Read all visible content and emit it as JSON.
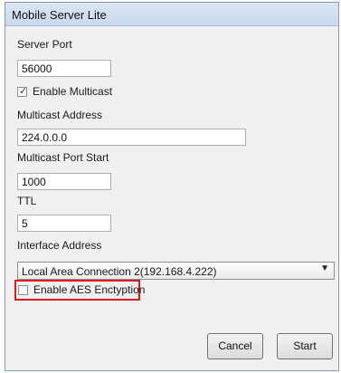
{
  "window": {
    "title": "Mobile Server Lite"
  },
  "form": {
    "server_port_label": "Server Port",
    "server_port_value": "56000",
    "enable_multicast_label": "Enable Multicast",
    "enable_multicast_checked": true,
    "multicast_address_label": "Multicast Address",
    "multicast_address_value": "224.0.0.0",
    "multicast_port_start_label": "Multicast Port Start",
    "multicast_port_start_value": "1000",
    "ttl_label": "TTL",
    "ttl_value": "5",
    "interface_address_label": "Interface Address",
    "interface_address_selected": "Local Area Connection 2(192.168.4.222)",
    "enable_aes_label": "Enable AES Enctyption",
    "enable_aes_checked": false
  },
  "buttons": {
    "cancel_label": "Cancel",
    "start_label": "Start"
  },
  "icons": {
    "dropdown_arrow": "chevron-down-icon",
    "checkmark": "checkmark-icon"
  },
  "colors": {
    "highlight_border": "#d91d1d",
    "titlebar": "#c9d9ee"
  }
}
